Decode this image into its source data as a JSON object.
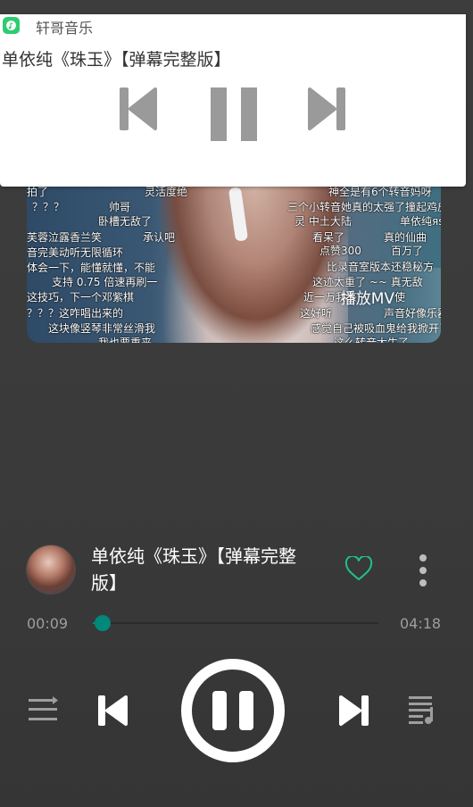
{
  "notification": {
    "app_name": "轩哥音乐",
    "song_title": "单依纯《珠玉》【弹幕完整版】"
  },
  "mv": {
    "label": "播放MV",
    "danmaku": [
      "拍了",
      "灵活度绝",
      "神全是有6个转音妈呀",
      "？？？",
      "帅哥",
      "三个小转音她真的太强了撞起鸡皮",
      "卧槽无敌了",
      "灵 中土大陆",
      "单依纯яs",
      "芙蓉泣露香兰笑",
      "承认吧",
      "看呆了",
      "真的仙曲",
      "音完美动听无限循环",
      "点赞300",
      "百万了",
      "体会一下，能懂就懂，不能",
      "比录音室版本还稳秘方",
      "支持 0.75 倍速再刷一",
      "这迹太重了 ~~ 真无敌",
      "这技巧，下一个邓紫棋",
      "近一万我来",
      "使",
      "？？？这咋唱出来的",
      "这好听",
      "声音好像乐器",
      "这块像竖琴非常丝滑我",
      "感觉自己被吸血鬼给我掀开了",
      "我也要重来",
      "这么转音太牛了"
    ]
  },
  "player": {
    "song_title": "单依纯《珠玉》【弹幕完整版】",
    "current_time": "00:09",
    "total_time": "04:18",
    "progress": 0.035,
    "liked": false
  },
  "colors": {
    "accent": "#00897b",
    "heart": "#1fbf8f",
    "icon_gray": "#9e9e9e",
    "notif_icon_gray": "#9a9a9a"
  },
  "icons": {
    "notif_app": "music-app-icon",
    "notif_prev": "skip-previous-icon",
    "notif_pause": "pause-icon",
    "notif_next": "skip-next-icon",
    "heart": "heart-outline-icon",
    "more": "more-vert-icon",
    "playlist": "playlist-icon",
    "prev": "skip-previous-icon",
    "play_pause": "pause-circle-icon",
    "next": "skip-next-icon",
    "queue": "queue-music-icon"
  }
}
